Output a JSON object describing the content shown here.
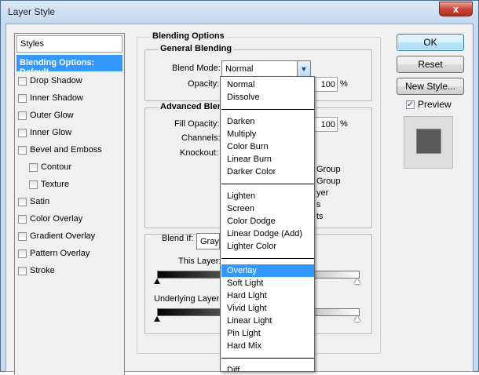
{
  "window": {
    "title": "Layer Style",
    "close_glyph": "x"
  },
  "styles_panel": {
    "header": "Styles",
    "selected": "Blending Options: Default",
    "items": [
      {
        "label": "Drop Shadow",
        "checked": false
      },
      {
        "label": "Inner Shadow",
        "checked": false
      },
      {
        "label": "Outer Glow",
        "checked": false
      },
      {
        "label": "Inner Glow",
        "checked": false
      },
      {
        "label": "Bevel and Emboss",
        "checked": false
      },
      {
        "label": "Contour",
        "checked": false
      },
      {
        "label": "Texture",
        "checked": false
      },
      {
        "label": "Satin",
        "checked": false
      },
      {
        "label": "Color Overlay",
        "checked": false
      },
      {
        "label": "Gradient Overlay",
        "checked": false
      },
      {
        "label": "Pattern Overlay",
        "checked": false
      },
      {
        "label": "Stroke",
        "checked": false
      }
    ]
  },
  "blending": {
    "group_title": "Blending Options",
    "general_title": "General Blending",
    "blend_mode_label": "Blend Mode:",
    "blend_mode_value": "Normal",
    "opacity_label": "Opacity:",
    "opacity_value": "100",
    "percent": "%",
    "advanced_title": "Advanced Blend",
    "fill_opacity_label": "Fill Opacity:",
    "fill_opacity_value": "100",
    "channels_label": "Channels:",
    "knockout_label": "Knockout:",
    "partial_labels": [
      "Group",
      "Group",
      "yer",
      "s",
      "ts"
    ],
    "blend_if_label": "Blend If:",
    "blend_if_value": "Gray",
    "this_layer_label": "This Layer:",
    "underlying_layer_label": "Underlying Layer:",
    "this_layer_range": [
      0,
      255
    ],
    "underlying_layer_range": [
      0,
      255
    ]
  },
  "buttons": {
    "ok": "OK",
    "reset": "Reset",
    "new_style": "New Style...",
    "preview": "Preview",
    "preview_checked": true
  },
  "blend_modes": [
    [
      "Normal",
      "Dissolve"
    ],
    [
      "Darken",
      "Multiply",
      "Color Burn",
      "Linear Burn",
      "Darker Color"
    ],
    [
      "Lighten",
      "Screen",
      "Color Dodge",
      "Linear Dodge (Add)",
      "Lighter Color"
    ],
    [
      "Overlay",
      "Soft Light",
      "Hard Light",
      "Vivid Light",
      "Linear Light",
      "Pin Light",
      "Hard Mix"
    ],
    [
      "Diff"
    ]
  ],
  "highlighted_mode": "Overlay",
  "colors": {
    "selection": "#3399ff",
    "frame": "#c6d9ef"
  }
}
